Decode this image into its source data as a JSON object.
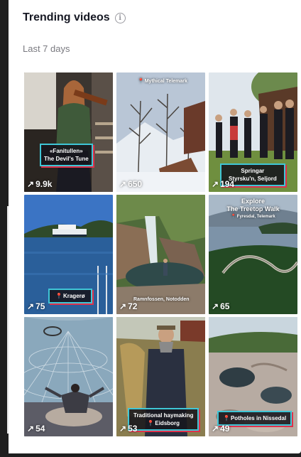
{
  "header": {
    "title": "Trending videos",
    "info_icon": "info-icon",
    "period": "Last 7 days"
  },
  "videos": [
    {
      "views": "9.9k",
      "caption_lines": [
        "«Fanitullen»",
        "The Devil's Tune"
      ]
    },
    {
      "views": "650",
      "location": "Mythical Telemark"
    },
    {
      "views": "194",
      "caption_lines": [
        "Springar",
        "Styrsku'n, Seljord"
      ]
    },
    {
      "views": "75",
      "caption_lines": [
        "Kragerø"
      ]
    },
    {
      "views": "72",
      "location": "Ramnfossen, Notodden"
    },
    {
      "views": "65",
      "caption_lines": [
        "Explore",
        "The Treetop Walk"
      ],
      "location": "Fyresdal, Telemark"
    },
    {
      "views": "54"
    },
    {
      "views": "53",
      "caption_lines": [
        "Traditional haymaking",
        "Eidsborg"
      ]
    },
    {
      "views": "49",
      "caption_lines": [
        "Potholes in Nissedal"
      ]
    }
  ],
  "colors": {
    "accent_cyan": "#3fc6d6",
    "accent_red": "#e0304a",
    "pin": "#e8314a"
  }
}
